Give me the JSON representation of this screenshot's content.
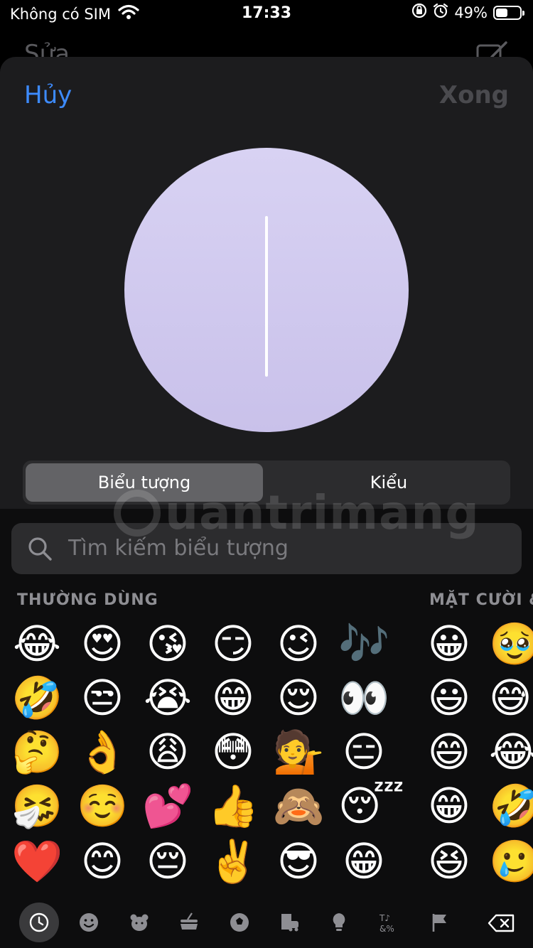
{
  "status": {
    "carrier": "Không có SIM",
    "time": "17:33",
    "battery": "49%",
    "battery_level": 0.49
  },
  "behind": {
    "title": "Sửa"
  },
  "header": {
    "cancel": "Hủy",
    "done": "Xong"
  },
  "segment": {
    "icon_label": "Biểu tượng",
    "style_label": "Kiểu"
  },
  "search": {
    "placeholder": "Tìm kiếm biểu tượng"
  },
  "watermark": "uantrimang",
  "sections": {
    "frequent": "THƯỜNG DÙNG",
    "smileys": "MẶT CƯỜI &"
  },
  "emojis": {
    "frequent": [
      [
        "😂",
        "😍",
        "😘",
        "😏",
        "😉",
        "🎶"
      ],
      [
        "🤣",
        "😒",
        "😭",
        "😁",
        "😌",
        "👀"
      ],
      [
        "🤔",
        "👌",
        "😩",
        "😳",
        "💁",
        "😑"
      ],
      [
        "🤧",
        "☺️",
        "💕",
        "👍",
        "🙈",
        "😴"
      ],
      [
        "❤️",
        "😊",
        "😔",
        "✌️",
        "😎",
        "😁"
      ]
    ],
    "smileys": [
      [
        "😀",
        "🥹"
      ],
      [
        "😃",
        "😅"
      ],
      [
        "😄",
        "😂"
      ],
      [
        "😁",
        "🤣"
      ],
      [
        "😆",
        "🥲"
      ]
    ]
  },
  "categories": [
    {
      "name": "recent",
      "active": true
    },
    {
      "name": "smileys"
    },
    {
      "name": "animals"
    },
    {
      "name": "food"
    },
    {
      "name": "activity"
    },
    {
      "name": "travel"
    },
    {
      "name": "objects"
    },
    {
      "name": "symbols"
    },
    {
      "name": "flags"
    },
    {
      "name": "delete"
    }
  ],
  "colors": {
    "accent": "#3d8bfd",
    "avatar_top": "#d8d2f3",
    "avatar_bottom": "#c9c1ea"
  }
}
